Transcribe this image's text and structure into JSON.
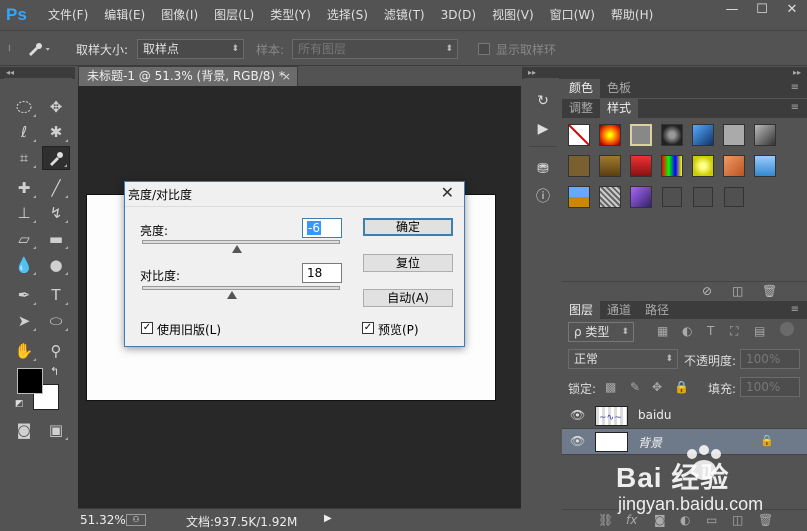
{
  "app": {
    "logo": "Ps",
    "menu": [
      "文件(F)",
      "编辑(E)",
      "图像(I)",
      "图层(L)",
      "类型(Y)",
      "选择(S)",
      "滤镜(T)",
      "3D(D)",
      "视图(V)",
      "窗口(W)",
      "帮助(H)"
    ],
    "window_controls": [
      "—",
      "☐",
      "✕"
    ]
  },
  "options": {
    "sample_size_label": "取样大小:",
    "sample_size_value": "取样点",
    "sample_label": "样本:",
    "sample_value": "所有图层",
    "show_ring_label": "显示取样环"
  },
  "document": {
    "tab_title": "未标题-1 @ 51.3% (背景, RGB/8) *",
    "tab_close": "×"
  },
  "status": {
    "zoom": "51.32%",
    "doc_info": "文档:937.5K/1.92M"
  },
  "dialog": {
    "title": "亮度/对比度",
    "close": "✕",
    "brightness_label": "亮度:",
    "brightness_value": "-6",
    "brightness_level": -6,
    "contrast_label": "对比度:",
    "contrast_value": "18",
    "contrast_level": 18,
    "ok_button": "确定",
    "reset_button": "复位",
    "auto_button": "自动(A)",
    "use_legacy_label": "使用旧版(L)",
    "use_legacy_checked": true,
    "preview_label": "预览(P)",
    "preview_checked": true
  },
  "panels": {
    "top_tabs": [
      "颜色",
      "色板"
    ],
    "mid_tabs": [
      "调整",
      "样式"
    ],
    "layers_tabs": [
      "图层",
      "通道",
      "路径"
    ],
    "filter_type": "ρ 类型",
    "blend_mode": "正常",
    "opacity_label": "不透明度:",
    "opacity_value": "100%",
    "lock_label": "锁定:",
    "fill_label": "填充:",
    "fill_value": "100%",
    "layers": [
      {
        "name": "baidu",
        "selected": false
      },
      {
        "name": "背景",
        "selected": true
      }
    ]
  },
  "watermark": {
    "brand": "Bai 经验",
    "url": "jingyan.baidu.com"
  }
}
